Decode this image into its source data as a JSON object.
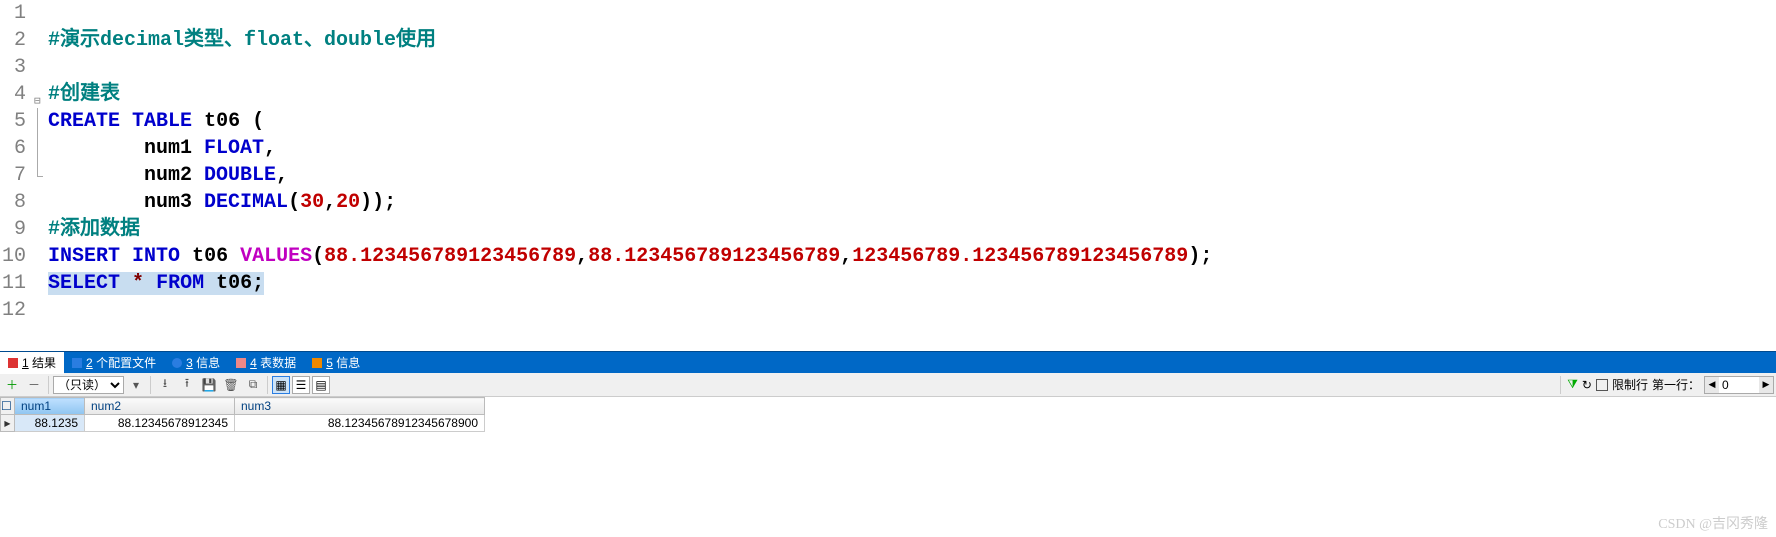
{
  "code": {
    "lines": [
      "1",
      "2",
      "3",
      "4",
      "5",
      "6",
      "7",
      "8",
      "9",
      "10",
      "11",
      "12"
    ],
    "comment1": "#演示decimal类型、float、double使用",
    "comment2": "#创建表",
    "kw_create": "CREATE",
    "kw_table": "TABLE",
    "tbl": "t06",
    "lparen": " (",
    "col1": "num1",
    "type1": "FLOAT",
    "comma": ",",
    "col2": "num2",
    "type2": "DOUBLE",
    "col3": "num3",
    "type3": "DECIMAL",
    "decargs_open": "(",
    "dec_p": "30",
    "dec_comma": ",",
    "dec_s": "20",
    "decargs_close": "));",
    "comment3": "#添加数据",
    "kw_insert": "INSERT",
    "kw_into": "INTO",
    "kw_values": "VALUES",
    "val_open": "(",
    "v1": "88.123456789123456789",
    "vsep1": ",",
    "v2": "88.123456789123456789",
    "vsep2": ",",
    "v3": "123456789.123456789123456789",
    "val_close": ");",
    "kw_select": "SELECT",
    "star": "*",
    "kw_from": "FROM",
    "sel_tbl": "t06",
    "semicolon": ";"
  },
  "tabs": {
    "results": {
      "num": "1",
      "label": "结果"
    },
    "profiles": {
      "num": "2",
      "label": "个配置文件"
    },
    "info": {
      "num": "3",
      "label": "信息"
    },
    "tabledata": {
      "num": "4",
      "label": "表数据"
    },
    "info2": {
      "num": "5",
      "label": "信息"
    }
  },
  "toolbar": {
    "mode": "（只读）",
    "limit_label": "限制行",
    "firstrow_label": "第一行：",
    "firstrow_value": "0"
  },
  "grid": {
    "headers": [
      "num1",
      "num2",
      "num3"
    ],
    "row": [
      "88.1235",
      "88.12345678912345",
      "88.12345678912345678900"
    ]
  },
  "watermark": "CSDN @吉冈秀隆",
  "chart_data": {
    "type": "table",
    "headers": [
      "num1",
      "num2",
      "num3"
    ],
    "rows": [
      [
        88.1235,
        88.12345678912345,
        "88.12345678912345678900"
      ]
    ]
  }
}
